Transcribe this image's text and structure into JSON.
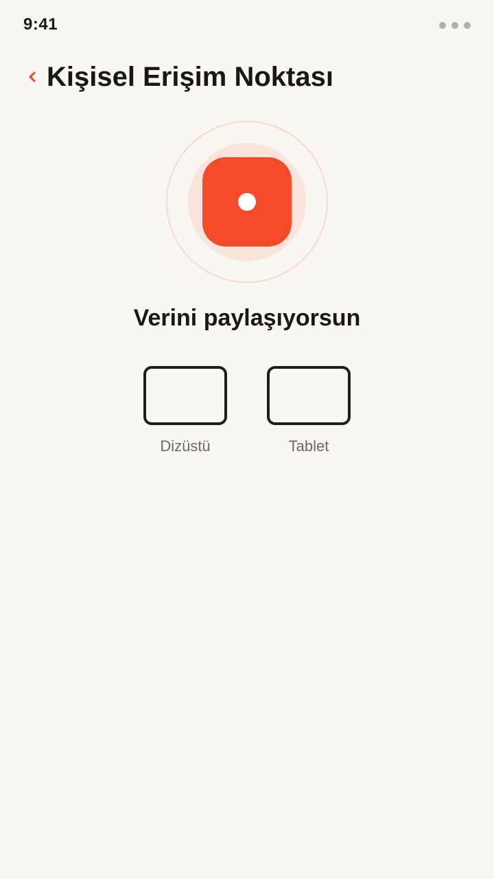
{
  "status_bar": {
    "time": "9:41",
    "menu_icon": "more-dots-icon"
  },
  "header": {
    "back_icon": "chevron-left-icon",
    "title": "Kişisel Erişim Noktası"
  },
  "hotspot": {
    "icon": "hotspot-icon",
    "status_text": "Verini paylaşıyorsun"
  },
  "devices": [
    {
      "label": "Dizüstü",
      "icon": "laptop-icon"
    },
    {
      "label": "Tablet",
      "icon": "tablet-icon"
    }
  ],
  "colors": {
    "accent": "#f54a2a",
    "ring_fill": "#fbe4dc",
    "ring_stroke": "#f6d9cf",
    "background": "#faf6f2",
    "text": "#1c1714",
    "muted_text": "#6f6864"
  }
}
